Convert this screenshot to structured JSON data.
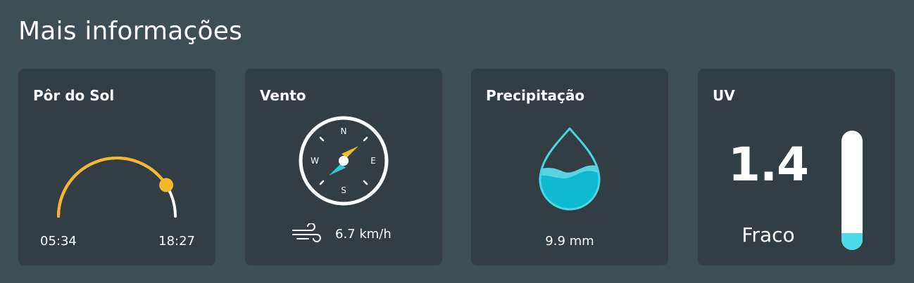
{
  "section": {
    "title": "Mais informações"
  },
  "sunset_card": {
    "title": "Pôr do Sol",
    "sunrise": "05:34",
    "sunset": "18:27",
    "day_progress": 0.82,
    "icons": [
      "sun-arc-icon",
      "sun-dot-icon"
    ],
    "colors": {
      "arc": "#f5b82b"
    }
  },
  "wind_card": {
    "title": "Vento",
    "compass": {
      "north": "N",
      "south": "S",
      "east": "E",
      "west": "W"
    },
    "speed": "6.7 km/h",
    "icons": [
      "compass-icon",
      "wind-icon"
    ],
    "colors": {
      "needle_north": "#f5b82b",
      "needle_south": "#35c6dd"
    }
  },
  "rain_card": {
    "title": "Precipitação",
    "amount": "9.9 mm",
    "icons": [
      "water-drop-icon"
    ],
    "colors": {
      "water": "#0fbad0",
      "water_light": "#58d3e3"
    }
  },
  "uv_card": {
    "title": "UV",
    "value": "1.4",
    "level": "Fraco",
    "bar_fill": 0.14,
    "colors": {
      "fill": "#4dd9e8"
    }
  }
}
